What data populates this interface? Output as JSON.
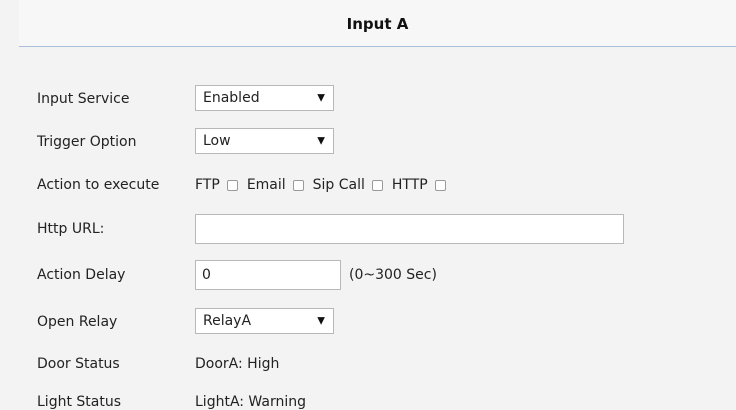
{
  "header": {
    "title": "Input A"
  },
  "form": {
    "input_service": {
      "label": "Input Service",
      "value": "Enabled"
    },
    "trigger_option": {
      "label": "Trigger Option",
      "value": "Low"
    },
    "action_to_execute": {
      "label": "Action to execute",
      "options": [
        {
          "label": "FTP",
          "checked": false
        },
        {
          "label": "Email",
          "checked": false
        },
        {
          "label": "Sip Call",
          "checked": false
        },
        {
          "label": "HTTP",
          "checked": false
        }
      ]
    },
    "http_url": {
      "label": "Http URL:",
      "value": ""
    },
    "action_delay": {
      "label": "Action Delay",
      "value": "0",
      "hint": "(0~300 Sec)"
    },
    "open_relay": {
      "label": "Open Relay",
      "value": "RelayA"
    },
    "door_status": {
      "label": "Door Status",
      "value": "DoorA: High"
    },
    "light_status": {
      "label": "Light Status",
      "value": "LightA: Warning"
    }
  },
  "icons": {
    "dropdown_arrow": "▼"
  },
  "colors": {
    "page_background": "#f3f3f3",
    "header_border": "#a9bedb"
  }
}
